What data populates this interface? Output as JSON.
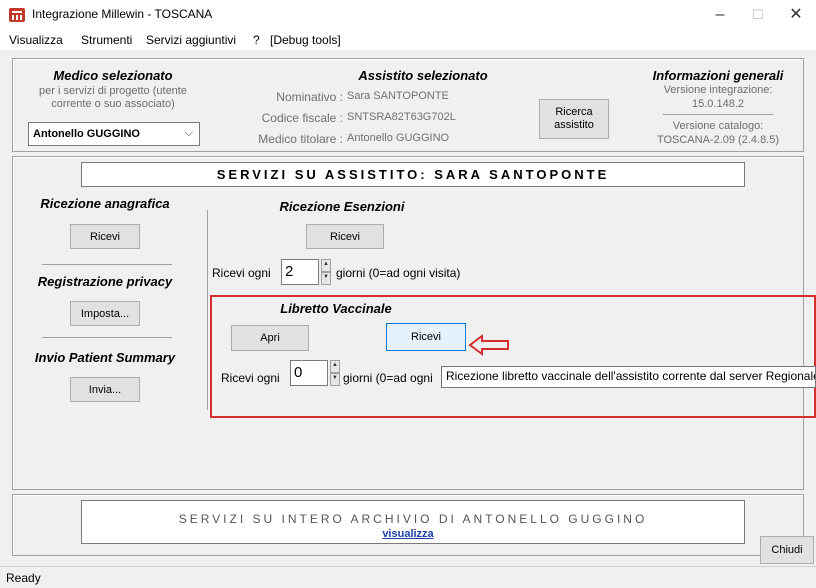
{
  "window": {
    "title": "Integrazione Millewin - TOSCANA",
    "minimize": "–",
    "maximize": "☐",
    "close": "✕"
  },
  "menu": [
    "Visualizza",
    "Strumenti",
    "Servizi aggiuntivi",
    "?",
    "[Debug tools]"
  ],
  "medico": {
    "title": "Medico selezionato",
    "description": "per i servizi di progetto (utente corrente o suo associato)",
    "selected": "Antonello GUGGINO"
  },
  "assistito": {
    "title": "Assistito selezionato",
    "rows": [
      {
        "label": "Nominativo :",
        "value": "Sara SANTOPONTE"
      },
      {
        "label": "Codice fiscale :",
        "value": "SNTSRA82T63G702L"
      },
      {
        "label": "Medico titolare :",
        "value": "Antonello GUGGINO"
      }
    ],
    "search_button": "Ricerca assistito"
  },
  "info": {
    "title": "Informazioni generali",
    "integration_label": "Versione integrazione:",
    "integration_value": "15.0.148.2",
    "catalog_label": "Versione catalogo:",
    "catalog_value": "TOSCANA-2.09 (2.4.8.5)"
  },
  "services": {
    "banner": "SERVIZI   SU   ASSISTITO:    SARA SANTOPONTE",
    "anagrafica": {
      "title": "Ricezione anagrafica",
      "button": "Ricevi"
    },
    "privacy": {
      "title": "Registrazione privacy",
      "button": "Imposta..."
    },
    "patient_summary": {
      "title": "Invio Patient Summary",
      "button": "Invia..."
    },
    "esenzioni": {
      "title": "Ricezione Esenzioni",
      "button": "Ricevi",
      "every_label": "Ricevi ogni",
      "every_value": "2",
      "days_label": "giorni (0=ad ogni visita)"
    },
    "libretto": {
      "title": "Libretto Vaccinale",
      "open_button": "Apri",
      "receive_button": "Ricevi",
      "every_label": "Ricevi ogni",
      "every_value": "0",
      "days_label": "giorni (0=ad ogni",
      "tooltip": "Ricezione libretto vaccinale dell'assistito corrente dal server Regionale"
    }
  },
  "archive": {
    "banner": "SERVIZI  SU  INTERO  ARCHIVIO  DI  ANTONELLO GUGGINO",
    "link": "visualizza"
  },
  "close_button": "Chiudi",
  "status": "Ready",
  "colors": {
    "highlight": "#d32f2f",
    "link": "#1a3faa",
    "focus": "#0078d7"
  }
}
